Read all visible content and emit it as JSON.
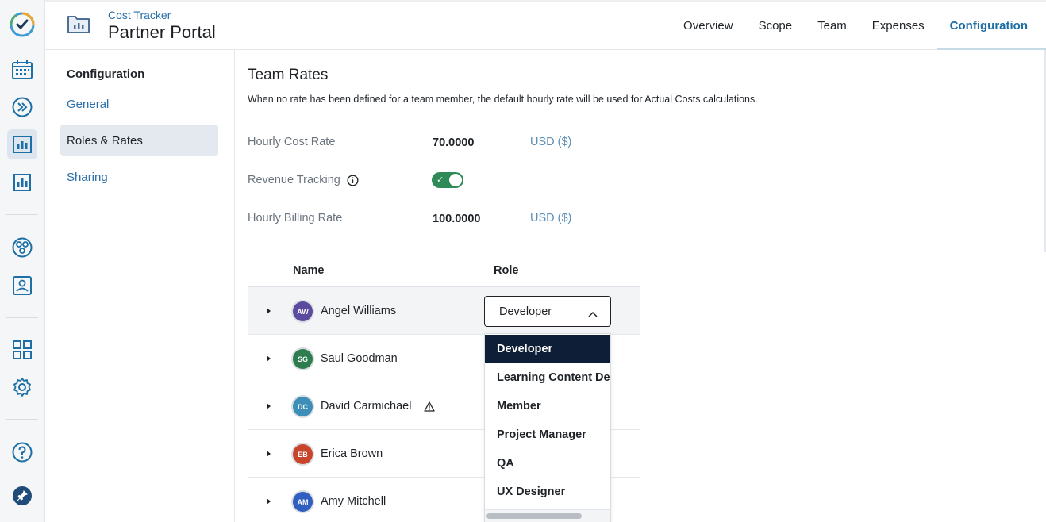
{
  "header": {
    "subtitle": "Cost Tracker",
    "title": "Partner Portal",
    "tabs": [
      {
        "label": "Overview",
        "active": false
      },
      {
        "label": "Scope",
        "active": false
      },
      {
        "label": "Team",
        "active": false
      },
      {
        "label": "Expenses",
        "active": false
      },
      {
        "label": "Configuration",
        "active": true
      }
    ]
  },
  "rail": {
    "icons": [
      "checkmark-logo-icon",
      "calendar-icon",
      "forward-icon",
      "report-icon",
      "bar-chart-icon",
      "team-icon",
      "contact-icon",
      "apps-grid-icon",
      "gear-icon",
      "help-icon",
      "pin-icon"
    ],
    "active": "report-icon"
  },
  "sidebar": {
    "heading": "Configuration",
    "items": [
      {
        "label": "General",
        "active": false
      },
      {
        "label": "Roles & Rates",
        "active": true
      },
      {
        "label": "Sharing",
        "active": false
      }
    ]
  },
  "main": {
    "title": "Team Rates",
    "description": "When no rate has been defined for a team member, the default hourly rate will be used for Actual Costs calculations.",
    "hourly_cost": {
      "label": "Hourly Cost Rate",
      "value": "70.0000",
      "unit": "USD ($)"
    },
    "revenue_tracking": {
      "label": "Revenue Tracking",
      "enabled": true
    },
    "hourly_billing": {
      "label": "Hourly Billing Rate",
      "value": "100.0000",
      "unit": "USD ($)"
    }
  },
  "table": {
    "columns": {
      "name": "Name",
      "role": "Role"
    },
    "rows": [
      {
        "initials": "AW",
        "name": "Angel Williams",
        "color": "#5b4a9e",
        "warning": false
      },
      {
        "initials": "SG",
        "name": "Saul Goodman",
        "color": "#2e7d4f",
        "warning": false
      },
      {
        "initials": "DC",
        "name": "David Carmichael",
        "color": "#3d8fb8",
        "warning": true
      },
      {
        "initials": "EB",
        "name": "Erica Brown",
        "color": "#c8452c",
        "warning": false
      },
      {
        "initials": "AM",
        "name": "Amy Mitchell",
        "color": "#2f5fbf",
        "warning": false
      }
    ]
  },
  "role_select": {
    "value": "Developer",
    "options": [
      "Developer",
      "Learning Content Developer",
      "Member",
      "Project Manager",
      "QA",
      "UX Designer"
    ],
    "selected": "Developer"
  },
  "colors": {
    "accent": "#1d6fa5",
    "toggle_on": "#2e8b57",
    "menu_selected": "#0e1e36"
  }
}
